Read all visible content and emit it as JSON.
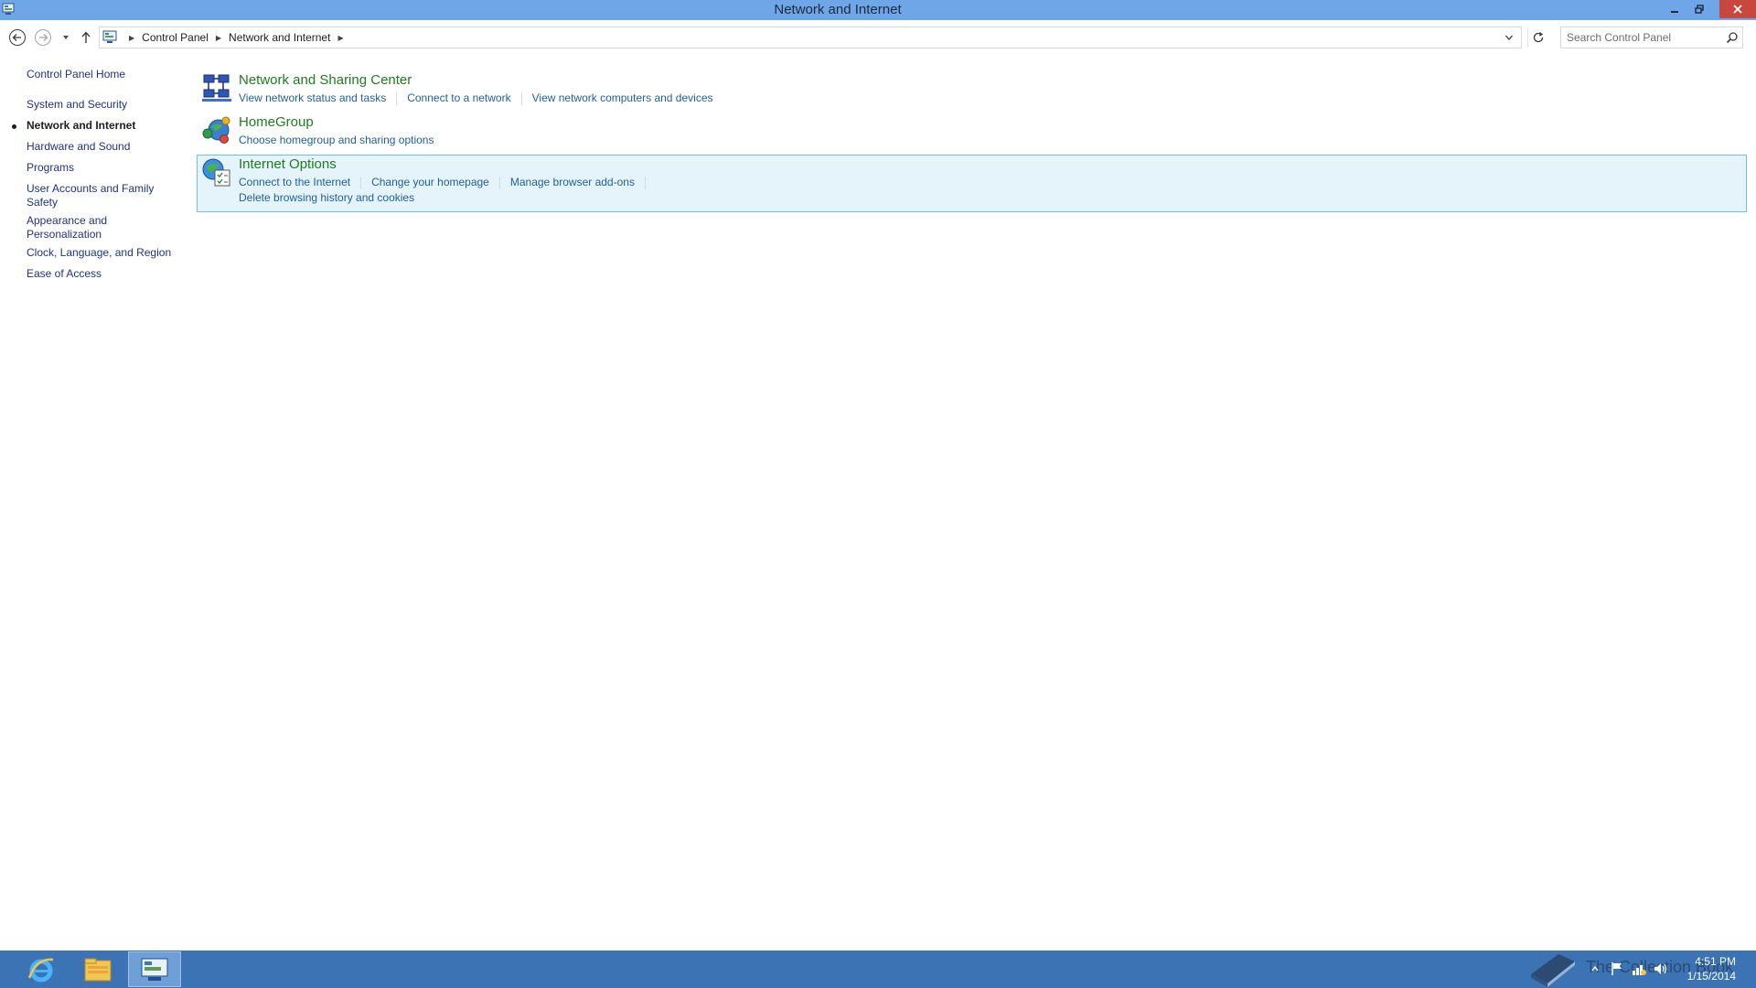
{
  "window": {
    "title": "Network and Internet"
  },
  "address": {
    "breadcrumbs": [
      "Control Panel",
      "Network and Internet"
    ],
    "search_placeholder": "Search Control Panel"
  },
  "sidebar": {
    "home": "Control Panel Home",
    "items": [
      {
        "label": "System and Security",
        "active": false
      },
      {
        "label": "Network and Internet",
        "active": true
      },
      {
        "label": "Hardware and Sound",
        "active": false
      },
      {
        "label": "Programs",
        "active": false
      },
      {
        "label": "User Accounts and Family Safety",
        "active": false
      },
      {
        "label": "Appearance and Personalization",
        "active": false
      },
      {
        "label": "Clock, Language, and Region",
        "active": false
      },
      {
        "label": "Ease of Access",
        "active": false
      }
    ]
  },
  "categories": [
    {
      "title": "Network and Sharing Center",
      "icon": "network-sharing-center-icon",
      "links": [
        "View network status and tasks",
        "Connect to a network",
        "View network computers and devices"
      ]
    },
    {
      "title": "HomeGroup",
      "icon": "homegroup-icon",
      "links": [
        "Choose homegroup and sharing options"
      ]
    },
    {
      "title": "Internet Options",
      "icon": "internet-options-icon",
      "highlighted": true,
      "links": [
        "Connect to the Internet",
        "Change your homepage",
        "Manage browser add-ons"
      ],
      "links_row2": [
        "Delete browsing history and cookies"
      ]
    }
  ],
  "taskbar": {
    "apps": [
      "internet-explorer-icon",
      "file-explorer-icon",
      "control-panel-icon"
    ],
    "active_app": "control-panel-icon",
    "clock_time": "4:51 PM",
    "clock_date": "1/15/2014",
    "watermark_text": "The Collection Book"
  },
  "colors": {
    "titlebar": "#6ea6e8",
    "taskbar": "#3c73b5",
    "link": "#1e5f9c",
    "category_title": "#1e7d1e",
    "highlight_bg": "#e5f3fb",
    "close_button": "#c7463e"
  }
}
